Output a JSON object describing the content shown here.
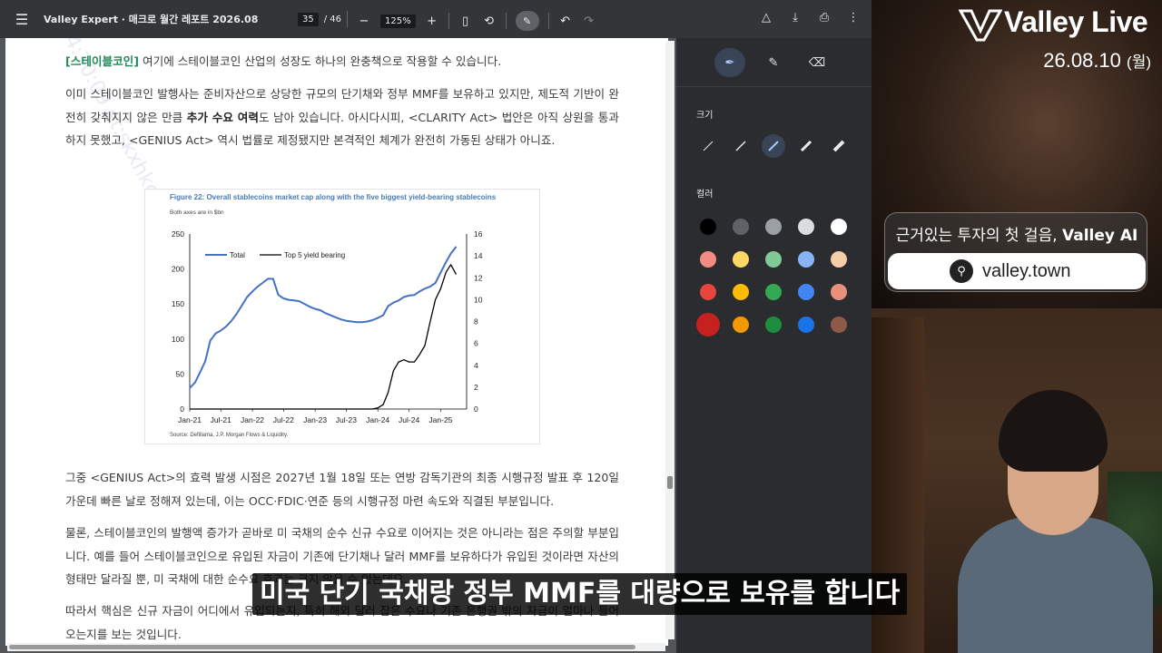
{
  "toolbar": {
    "title": "Valley Expert · 매크로 월간 레포트 2026.08",
    "page_current": "35",
    "page_total": "/ 46",
    "zoom": "125%"
  },
  "document": {
    "para1_tag": "[스테이블코인]",
    "para1_text": " 여기에 스테이블코인 산업의 성장도 하나의 완충책으로 작용할 수 있습니다.",
    "para2_a": "이미 스테이블코인 발행사는 준비자산으로 상당한 규모의 단기채와 정부 MMF를 보유하고 있지만, 제도적 기반이 완전히 갖춰지지 않은 만큼 ",
    "para2_bold": "추가 수요 여력",
    "para2_b": "도 남아 있습니다. 아시다시피, <CLARITY Act> 법안은 아직 상원을 통과하지 못했고, <GENIUS Act> 역시 법률로 제정됐지만 본격적인 체계가 완전히 가동된 상태가 아니죠.",
    "para3": "그중 <GENIUS Act>의 효력 발생 시점은 2027년 1월 18일 또는 연방 감독기관의 최종 시행규정 발표 후 120일 가운데 빠른 날로 정해져 있는데, 이는 OCC·FDIC·연준 등의 시행규정 마련 속도와 직결된 부분입니다.",
    "para4": "물론, 스테이블코인의 발행액 증가가 곧바로 미 국채의 순수 신규 수요로 이어지는 것은 아니라는 점은 주의할 부분입니다. 예를 들어 스테이블코인으로 유입된 자금이 기존에 단기채나 달러 MMF를 보유하다가 유입된 것이라면 자산의 형태만 달라질 뿐, 미 국채에 대한 순수요 효과는 크지 않을 수 있는데요.",
    "para5": "따라서 핵심은 신규 자금이 어디에서 유입되는지, 특히 해외 달러 잡은 수요나 기존 은행권 밖의 자금이 얼마나 들어오는지를 보는 것입니다.",
    "watermark": "14:30:09 et:skxhkc premium version"
  },
  "figure": {
    "title": "Figure 22: Overall stablecoins market cap along with the five biggest yield-bearing stablecoins",
    "subtitle": "Both axes are in $bn",
    "source": "Source: Defillama, J.P. Morgan Flows & Liquidity."
  },
  "chart_data": {
    "type": "line",
    "title": "Figure 22: Overall stablecoins market cap along with the five biggest yield-bearing stablecoins",
    "subtitle": "Both axes are in $bn",
    "x_ticks": [
      "Jan-21",
      "Jul-21",
      "Jan-22",
      "Jul-22",
      "Jan-23",
      "Jul-23",
      "Jan-24",
      "Jul-24",
      "Jan-25"
    ],
    "y_left": {
      "ylim": [
        0,
        250
      ],
      "ticks": [
        0,
        50,
        100,
        150,
        200,
        250
      ]
    },
    "y_right": {
      "ylim": [
        0,
        16
      ],
      "ticks": [
        0,
        2,
        4,
        6,
        8,
        10,
        12,
        14,
        16
      ]
    },
    "series": [
      {
        "name": "Total",
        "axis": "left",
        "color": "#4472c4",
        "x": [
          "2021-01",
          "2021-02",
          "2021-03",
          "2021-04",
          "2021-05",
          "2021-06",
          "2021-07",
          "2021-08",
          "2021-09",
          "2021-10",
          "2021-11",
          "2021-12",
          "2022-01",
          "2022-02",
          "2022-03",
          "2022-04",
          "2022-05",
          "2022-06",
          "2022-07",
          "2022-08",
          "2022-09",
          "2022-10",
          "2022-11",
          "2022-12",
          "2023-01",
          "2023-02",
          "2023-03",
          "2023-04",
          "2023-05",
          "2023-06",
          "2023-07",
          "2023-08",
          "2023-09",
          "2023-10",
          "2023-11",
          "2023-12",
          "2024-01",
          "2024-02",
          "2024-03",
          "2024-04",
          "2024-05",
          "2024-06",
          "2024-07",
          "2024-08",
          "2024-09",
          "2024-10",
          "2024-11",
          "2024-12",
          "2025-01",
          "2025-02",
          "2025-03",
          "2025-04"
        ],
        "values": [
          30,
          38,
          52,
          68,
          98,
          108,
          112,
          118,
          126,
          136,
          148,
          160,
          168,
          175,
          180,
          186,
          186,
          163,
          158,
          156,
          155,
          154,
          150,
          146,
          143,
          141,
          137,
          134,
          131,
          128,
          126,
          125,
          124,
          124,
          125,
          127,
          130,
          134,
          147,
          152,
          155,
          160,
          162,
          163,
          168,
          172,
          175,
          180,
          195,
          210,
          222,
          232
        ]
      },
      {
        "name": "Top 5 yield bearing",
        "axis": "right",
        "color": "#000000",
        "x": [
          "2021-01",
          "2023-06",
          "2023-09",
          "2023-12",
          "2024-01",
          "2024-02",
          "2024-03",
          "2024-04",
          "2024-05",
          "2024-06",
          "2024-07",
          "2024-08",
          "2024-09",
          "2024-10",
          "2024-11",
          "2024-12",
          "2025-01",
          "2025-02",
          "2025-03",
          "2025-04"
        ],
        "values": [
          0,
          0,
          0,
          0,
          0.1,
          0.4,
          1.5,
          3.5,
          4.3,
          4.5,
          4.3,
          4.3,
          5.0,
          5.8,
          8.0,
          10.0,
          11.0,
          12.5,
          13.2,
          12.3
        ]
      }
    ],
    "legend": "top-left"
  },
  "panel": {
    "size_label": "크기",
    "color_label": "컬러",
    "colors": [
      [
        "#000000",
        "#5f6368",
        "#9aa0a6",
        "#dadce0",
        "#ffffff"
      ],
      [
        "#f28b82",
        "#fdd663",
        "#81c995",
        "#8ab4f8",
        "#f6cda8"
      ],
      [
        "#e8453c",
        "#fbbc04",
        "#34a853",
        "#4285f4",
        "#e8907c"
      ],
      [
        "#c5221f",
        "#f29900",
        "#1e8e3e",
        "#1a73e8",
        "#8d5a48"
      ]
    ]
  },
  "overlay": {
    "brand": "Valley Live",
    "date": "26.08.10",
    "weekday": "(월)",
    "promo_text_a": "근거있는 투자의 첫 걸음, ",
    "promo_text_b": "Valley AI",
    "promo_url": "valley.town",
    "subtitle": "미국 단기 국채랑 정부 MMF를 대량으로 보유를 합니다"
  }
}
